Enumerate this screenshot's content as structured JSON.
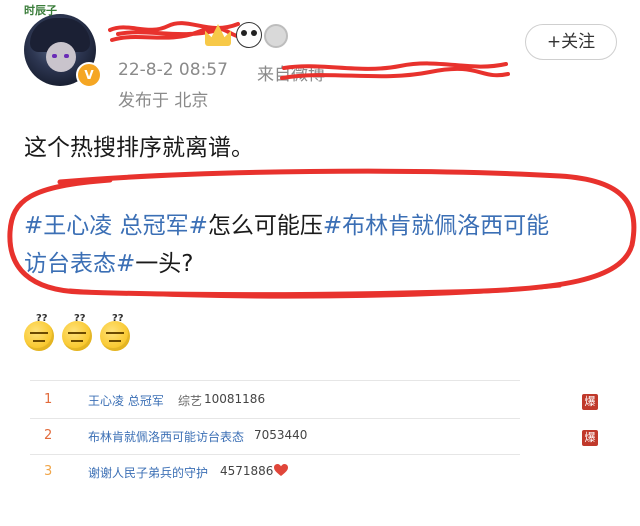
{
  "post": {
    "avatar_tag": "时辰子",
    "date": "22-8-2 08:57",
    "source_prefix": "来自微博",
    "location": "发布于 北京",
    "follow_label": "+关注",
    "text_line1": "这个热搜排序就离谱。",
    "tag1": "#王心凌 总冠军#",
    "mid_text": "怎么可能压",
    "tag2_part1": "#布林肯就佩洛西可能",
    "tag2_part2": "访台表态#",
    "end_text": "一头?",
    "verified_badge": "V"
  },
  "hot_list": [
    {
      "rank": "1",
      "title": "王心凌 总冠军",
      "category": "综艺",
      "count": "10081186",
      "badge": "爆"
    },
    {
      "rank": "2",
      "title": "布林肯就佩洛西可能访台表态",
      "category": "",
      "count": "7053440",
      "badge": "爆"
    },
    {
      "rank": "3",
      "title": "谢谢人民子弟兵的守护",
      "category": "",
      "count": "4571886",
      "badge": ""
    }
  ],
  "colors": {
    "tag": "#3b6fb5",
    "scribble": "#e8322d",
    "hot_badge": "#c0392b"
  },
  "icons": [
    "crown-icon",
    "panda-icon",
    "medal-icon",
    "heart-icon",
    "confused-emoji"
  ]
}
